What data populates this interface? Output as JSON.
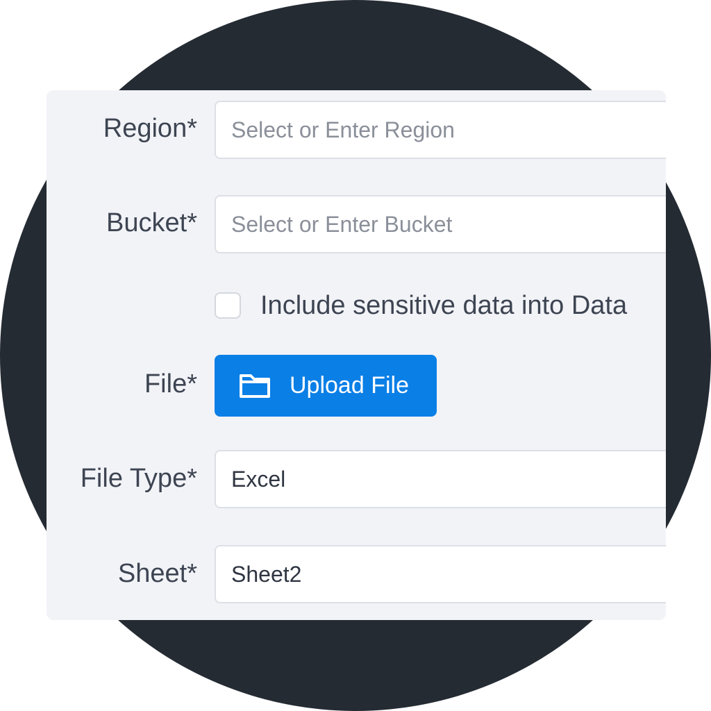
{
  "form": {
    "region": {
      "label": "Region*",
      "placeholder": "Select or Enter Region",
      "value": ""
    },
    "bucket": {
      "label": "Bucket*",
      "placeholder": "Select or Enter Bucket",
      "value": ""
    },
    "sensitive_data": {
      "label": "Include sensitive data into Data",
      "checked": false
    },
    "file": {
      "label": "File*",
      "button_label": "Upload File",
      "icon": "folder-icon"
    },
    "file_type": {
      "label": "File Type*",
      "value": "Excel"
    },
    "sheet": {
      "label": "Sheet*",
      "value": "Sheet2"
    }
  },
  "colors": {
    "backdrop": "#252b33",
    "panel": "#f2f3f7",
    "accent": "#0a7fe6",
    "label_text": "#3d4452",
    "placeholder_text": "#8a8f99"
  }
}
